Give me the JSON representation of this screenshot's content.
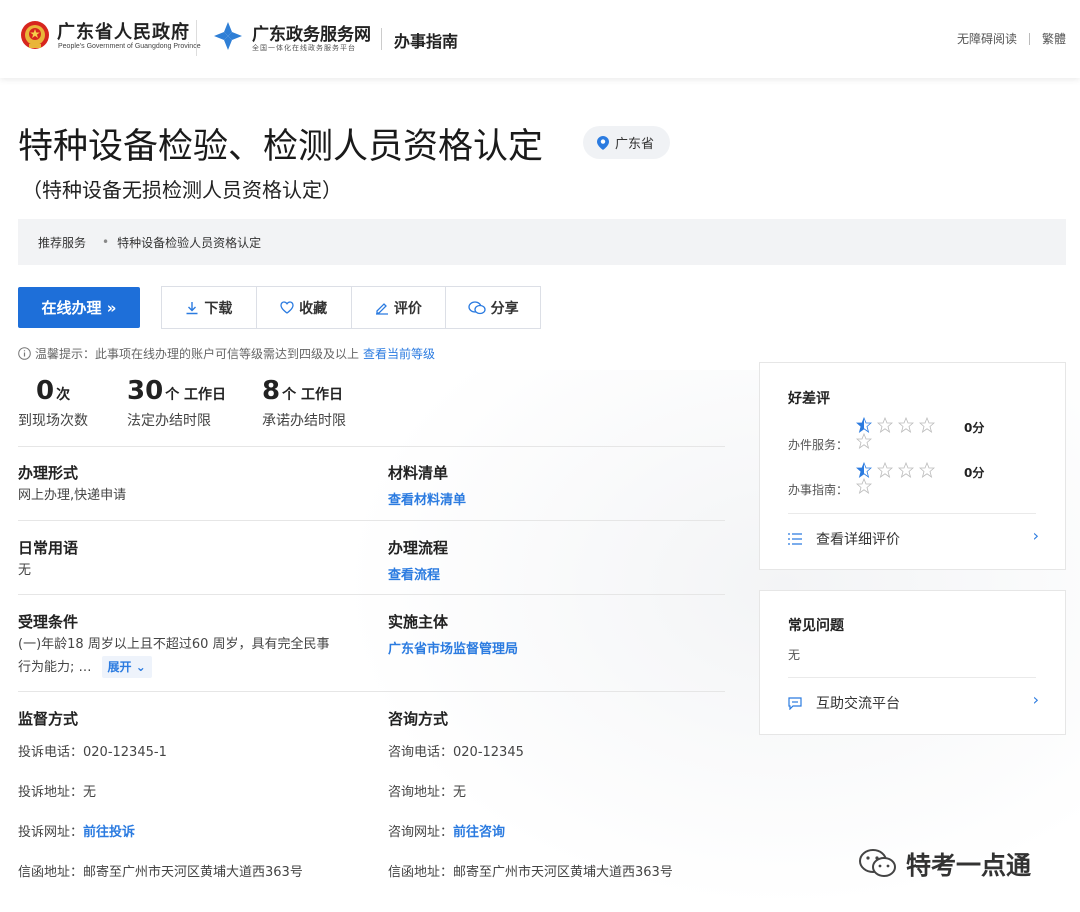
{
  "header": {
    "gov_name": "广东省人民政府",
    "gov_sub": "People's Government of Guangdong Province",
    "svc_name": "广东政务服务网",
    "svc_sub": "全国一体化在线政务服务平台",
    "guide_title": "办事指南",
    "accessibility": "无障碍阅读",
    "traditional": "繁體"
  },
  "main": {
    "title": "特种设备检验、检测人员资格认定",
    "region": "广东省",
    "subtitle": "（特种设备无损检测人员资格认定）",
    "recommend_label": "推荐服务",
    "recommend_item": "特种设备检验人员资格认定"
  },
  "actions": {
    "online": "在线办理 »",
    "download": "下载",
    "favorite": "收藏",
    "evaluate": "评价",
    "share": "分享"
  },
  "tip": {
    "text": "温馨提示：此事项在线办理的账户可信等级需达到四级及以上",
    "link": "查看当前等级"
  },
  "stats": [
    {
      "num": "0",
      "unit": "次",
      "label": "到现场次数"
    },
    {
      "num": "30",
      "unit": "个 工作日",
      "label": "法定办结时限"
    },
    {
      "num": "8",
      "unit": "个 工作日",
      "label": "承诺办结时限"
    }
  ],
  "info": {
    "form_h": "办理形式",
    "form_v": "网上办理,快递申请",
    "materials_h": "材料清单",
    "materials_link": "查看材料清单",
    "terms_h": "日常用语",
    "terms_v": "无",
    "process_h": "办理流程",
    "process_link": "查看流程",
    "cond_h": "受理条件",
    "cond_v1": "(一)年龄18 周岁以上且不超过60 周岁，具有完全民事",
    "cond_v2": "行为能力; …",
    "expand": "展开 ⌄",
    "subject_h": "实施主体",
    "subject_link": "广东省市场监督管理局",
    "supervise_h": "监督方式",
    "consult_h": "咨询方式",
    "complaint_phone_label": "投诉电话：",
    "complaint_phone": "020-12345-1",
    "complaint_addr_label": "投诉地址：",
    "complaint_addr": "无",
    "complaint_web_label": "投诉网址：",
    "complaint_web": "前往投诉",
    "complaint_mail_label": "信函地址：",
    "complaint_mail": "邮寄至广州市天河区黄埔大道西363号",
    "consult_phone_label": "咨询电话：",
    "consult_phone": "020-12345",
    "consult_addr_label": "咨询地址：",
    "consult_addr": "无",
    "consult_web_label": "咨询网址：",
    "consult_web": "前往咨询",
    "consult_mail_label": "信函地址：",
    "consult_mail": "邮寄至广州市天河区黄埔大道西363号"
  },
  "rating": {
    "title": "好差评",
    "service_label": "办件服务：",
    "service_score": "0分",
    "service_stars": 0.5,
    "guide_label": "办事指南：",
    "guide_score": "0分",
    "guide_stars": 0.5,
    "detail_link": "查看详细评价"
  },
  "faq": {
    "title": "常见问题",
    "value": "无",
    "link": "互助交流平台"
  },
  "watermark": "特考一点通",
  "colors": {
    "accent": "#1e6fd9",
    "link": "#2b7be0"
  }
}
